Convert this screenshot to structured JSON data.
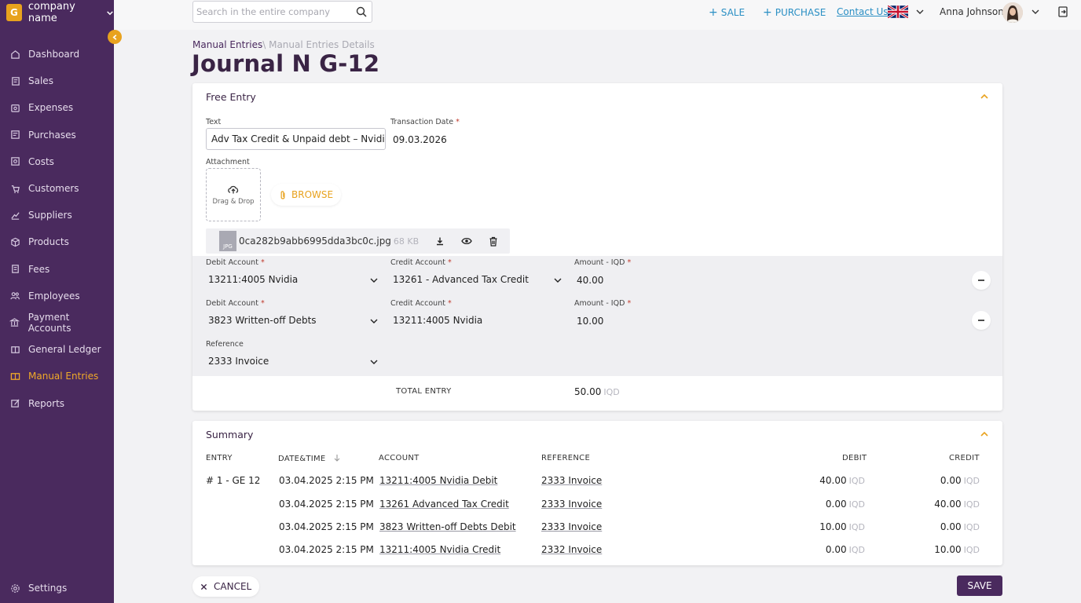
{
  "company": {
    "logo_letter": "G",
    "name": "company name"
  },
  "sidebar": {
    "items": [
      {
        "label": "Dashboard",
        "icon": "home-icon"
      },
      {
        "label": "Sales",
        "icon": "sales-icon"
      },
      {
        "label": "Expenses",
        "icon": "expenses-icon"
      },
      {
        "label": "Purchases",
        "icon": "purchases-icon"
      },
      {
        "label": "Costs",
        "icon": "costs-icon"
      },
      {
        "label": "Customers",
        "icon": "customers-icon"
      },
      {
        "label": "Suppliers",
        "icon": "suppliers-icon"
      },
      {
        "label": "Products",
        "icon": "products-icon"
      },
      {
        "label": "Fees",
        "icon": "fees-icon"
      },
      {
        "label": "Employees",
        "icon": "employees-icon"
      },
      {
        "label": "Payment Accounts",
        "icon": "bank-icon"
      },
      {
        "label": "General Ledger",
        "icon": "ledger-icon"
      },
      {
        "label": "Manual Entries",
        "icon": "book-icon",
        "active": true
      },
      {
        "label": "Reports",
        "icon": "reports-icon"
      }
    ],
    "settings_label": "Settings"
  },
  "topbar": {
    "search_placeholder": "Search in the entire company",
    "sale_label": "SALE",
    "purchase_label": "PURCHASE",
    "contact_label": "Contact Us",
    "user_name": "Anna Johnson"
  },
  "breadcrumb": {
    "main": "Manual Entries",
    "sep": "\\",
    "sub": "Manual Entries Details"
  },
  "title": "Journal N G-12",
  "free_entry": {
    "title": "Free Entry",
    "text_label": "Text",
    "text_value": "Adv Tax Credit & Unpaid debt – Nvidia",
    "date_label": "Transaction Date",
    "date_value": "09.03.2026",
    "attachment_label": "Attachment",
    "drag_drop": "Drag & Drop",
    "browse": "BROWSE",
    "file": {
      "name": "0ca282b9abb6995dda3bc0c.jpg",
      "size": "68 KB",
      "type": "JPG"
    },
    "lines": [
      {
        "debit_label": "Debit Account",
        "debit": "13211:4005 Nvidia",
        "credit_label": "Credit Account",
        "credit": "13261 - Advanced Tax Credit",
        "amount_label": "Amount - IQD",
        "amount": "40.00"
      },
      {
        "debit_label": "Debit Account",
        "debit": "3823 Written-off Debts",
        "credit_label": "Credit Account",
        "credit": "13211:4005 Nvidia",
        "amount_label": "Amount - IQD",
        "amount": "10.00"
      }
    ],
    "reference_label": "Reference",
    "reference_value": "2333 Invoice",
    "total_label": "TOTAL ENTRY",
    "total_value": "50.00",
    "currency": "IQD"
  },
  "summary": {
    "title": "Summary",
    "headers": {
      "entry": "ENTRY",
      "datetime": "DATE&TIME",
      "account": "ACCOUNT",
      "reference": "REFERENCE",
      "debit": "DEBIT",
      "credit": "CREDIT"
    },
    "entry_label": "# 1 - GE 12",
    "currency": "IQD",
    "rows": [
      {
        "datetime": "03.04.2025 2:15 PM",
        "account": "13211:4005 Nvidia Debit",
        "reference": "2333 Invoice",
        "debit": "40.00",
        "credit": "0.00"
      },
      {
        "datetime": "03.04.2025 2:15 PM",
        "account": "13261 Advanced Tax Credit",
        "reference": "2333 Invoice",
        "debit": "0.00",
        "credit": "40.00"
      },
      {
        "datetime": "03.04.2025 2:15 PM",
        "account": "3823 Written-off Debts Debit",
        "reference": "2333 Invoice",
        "debit": "10.00",
        "credit": "0.00"
      },
      {
        "datetime": "03.04.2025 2:15 PM",
        "account": "13211:4005 Nvidia Credit",
        "reference": "2332 Invoice",
        "debit": "0.00",
        "credit": "10.00"
      }
    ]
  },
  "actions": {
    "cancel": "CANCEL",
    "save": "SAVE"
  },
  "colors": {
    "sidebar": "#4a2a5e",
    "accent": "#e8a21e",
    "link": "#2a8fc4"
  }
}
